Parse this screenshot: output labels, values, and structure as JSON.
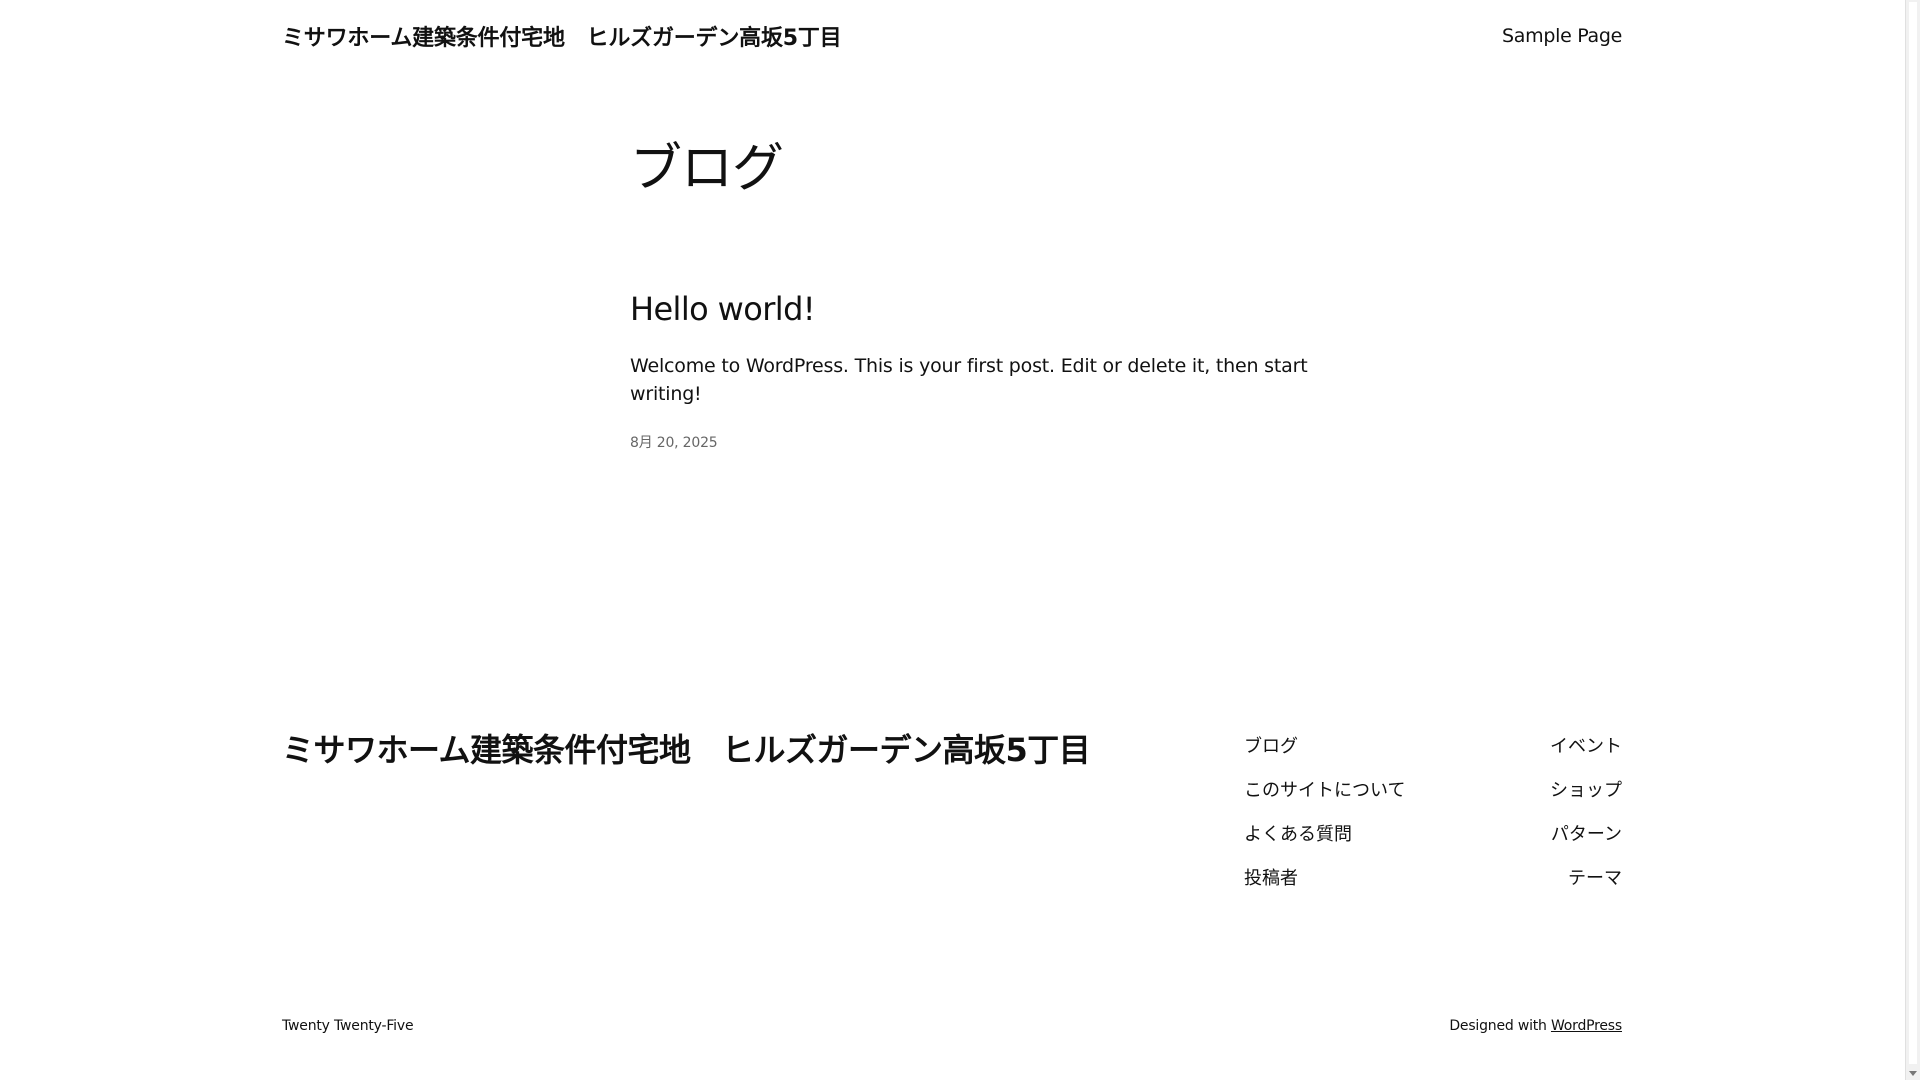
{
  "header": {
    "site_title": "ミサワホーム建築条件付宅地　ヒルズガーデン高坂5丁目",
    "nav": [
      "Sample Page"
    ]
  },
  "main": {
    "heading": "ブログ",
    "posts": [
      {
        "title": "Hello world!",
        "excerpt": "Welcome to WordPress. This is your first post. Edit or delete it, then start writing!",
        "date": "8月 20, 2025"
      }
    ]
  },
  "footer": {
    "site_title": "ミサワホーム建築条件付宅地　ヒルズガーデン高坂5丁目",
    "col1": [
      "ブログ",
      "このサイトについて",
      "よくある質問",
      "投稿者"
    ],
    "col2": [
      "イベント",
      "ショップ",
      "パターン",
      "テーマ"
    ],
    "theme_name": "Twenty Twenty-Five",
    "designed_with_prefix": "Designed with ",
    "designed_with_link": "WordPress"
  },
  "icons": {
    "scroll_down": "chevron-down-icon"
  }
}
